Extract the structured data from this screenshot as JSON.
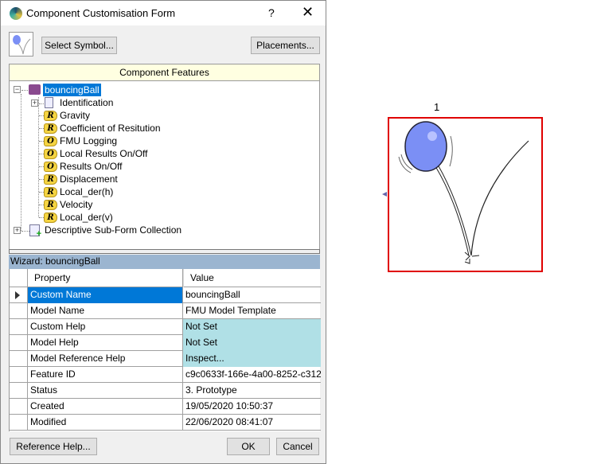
{
  "window": {
    "title": "Component Customisation Form",
    "help": "?",
    "close": "✕"
  },
  "toolbar": {
    "select_symbol": "Select Symbol...",
    "placements": "Placements..."
  },
  "features": {
    "header": "Component Features",
    "root": "bouncingBall",
    "items": [
      {
        "label": "Identification",
        "icon": "document-icon"
      },
      {
        "label": "Gravity",
        "icon": "R"
      },
      {
        "label": "Coefficient of Resitution",
        "icon": "R"
      },
      {
        "label": "FMU Logging",
        "icon": "O"
      },
      {
        "label": "Local Results On/Off",
        "icon": "O"
      },
      {
        "label": "Results On/Off",
        "icon": "O"
      },
      {
        "label": "Displacement",
        "icon": "R"
      },
      {
        "label": "Local_der(h)",
        "icon": "R"
      },
      {
        "label": "Velocity",
        "icon": "R"
      },
      {
        "label": "Local_der(v)",
        "icon": "R"
      }
    ],
    "collection": "Descriptive Sub-Form Collection"
  },
  "wizard": {
    "title": "Wizard: bouncingBall",
    "headers": {
      "property": "Property",
      "value": "Value"
    },
    "rows": [
      {
        "property": "Custom Name",
        "value": "bouncingBall",
        "selected": true
      },
      {
        "property": "Model Name",
        "value": "FMU Model Template"
      },
      {
        "property": "Custom Help",
        "value": "Not Set",
        "highlight": true
      },
      {
        "property": "Model  Help",
        "value": "Not Set",
        "highlight": true
      },
      {
        "property": "Model Reference Help",
        "value": "Inspect...",
        "highlight": true
      },
      {
        "property": "Feature ID",
        "value": "c9c0633f-166e-4a00-8252-c312..."
      },
      {
        "property": "Status",
        "value": " 3. Prototype"
      },
      {
        "property": "Created",
        "value": "19/05/2020 10:50:37"
      },
      {
        "property": "Modified",
        "value": "22/06/2020 08:41:07"
      }
    ]
  },
  "buttons": {
    "reference_help": "Reference Help...",
    "ok": "OK",
    "cancel": "Cancel"
  },
  "symbol": {
    "label": "1",
    "ball_color": "#7b8ff5",
    "border_color": "#e00000"
  }
}
